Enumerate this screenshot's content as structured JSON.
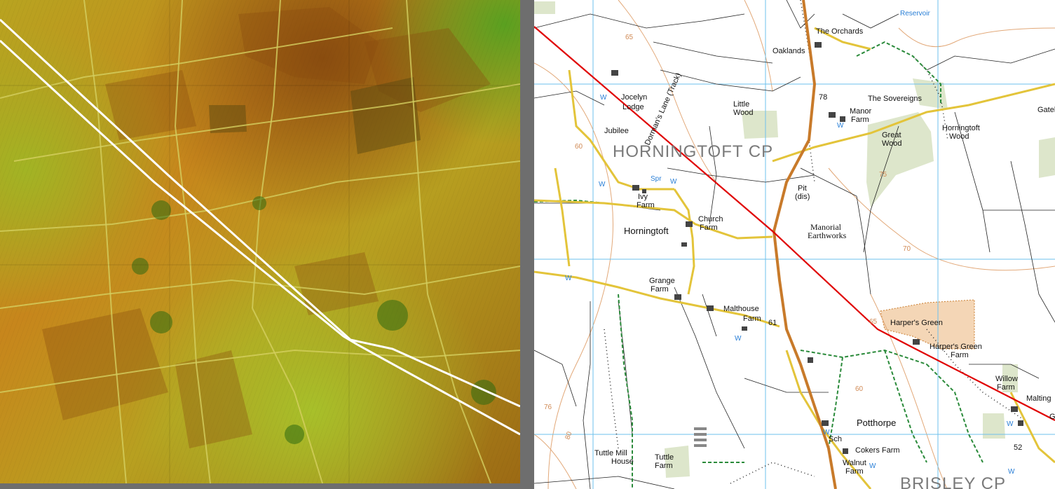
{
  "lidar_panel": {
    "colors": {
      "high": "#a05a10",
      "mid": "#c89a20",
      "low": "#7fb020",
      "route": "#ffffff"
    }
  },
  "os_map": {
    "parish_labels": [
      "HORNINGTOFT CP",
      "BRISLEY CP"
    ],
    "place_labels": {
      "orchards": "The Orchards",
      "oaklands": "Oaklands",
      "reservoir": "Reservoir",
      "jocelyn": "Jocelyn",
      "lodge": "Lodge",
      "jubilee": "Jubilee",
      "dormans_lane": "Dorman's Lane (Track)",
      "little": "Little",
      "wood": "Wood",
      "sovereigns": "The Sovereigns",
      "manor": "Manor",
      "manor_farm": "Farm",
      "great": "Great",
      "great_wood": "Wood",
      "horningtoft_wood_1": "Horningtoft",
      "horningtoft_wood_2": "Wood",
      "gatel": "Gatel",
      "spr": "Spr",
      "ivy": "Ivy",
      "ivy_farm": "Farm",
      "pit": "Pit",
      "dis": "(dis)",
      "horningtoft": "Horningtoft",
      "church_farm_1": "Church",
      "church_farm_2": "Farm",
      "manorial": "Manorial",
      "earthworks": "Earthworks",
      "grange": "Grange",
      "grange_farm": "Farm",
      "malthouse": "Malthouse",
      "malthouse_farm": "Farm",
      "harpers_green": "Harper's Green",
      "harpers_green_farm_1": "Harper's Green",
      "harpers_green_farm_2": "Farm",
      "willow": "Willow",
      "willow_farm": "Farm",
      "malting": "Malting",
      "potthorpe": "Potthorpe",
      "sch": "Sch",
      "cokers_farm": "Cokers Farm",
      "walnut": "Walnut",
      "walnut_farm": "Farm",
      "tuttle_mill": "Tuttle Mill",
      "tuttle_house": "House",
      "tuttle": "Tuttle",
      "tuttle_farm": "Farm",
      "g": "G"
    },
    "heights": {
      "h78": "78",
      "h61": "61",
      "h52": "52",
      "h76": "76",
      "h60a": "60",
      "h60b": "60",
      "h65a": "65",
      "h65b": "65",
      "h70": "70",
      "h75": "75",
      "h80": "80"
    },
    "water_marks": [
      "W",
      "W",
      "W",
      "W",
      "W",
      "W",
      "W",
      "W",
      "W",
      "W"
    ],
    "colors": {
      "grid": "#5ab4e6",
      "road_orange": "#c87a2a",
      "road_yellow": "#e8c93a",
      "route": "#e00000",
      "contour": "#e0a070",
      "wood": "#dfe8cc",
      "path": "#2a8a3a"
    }
  }
}
